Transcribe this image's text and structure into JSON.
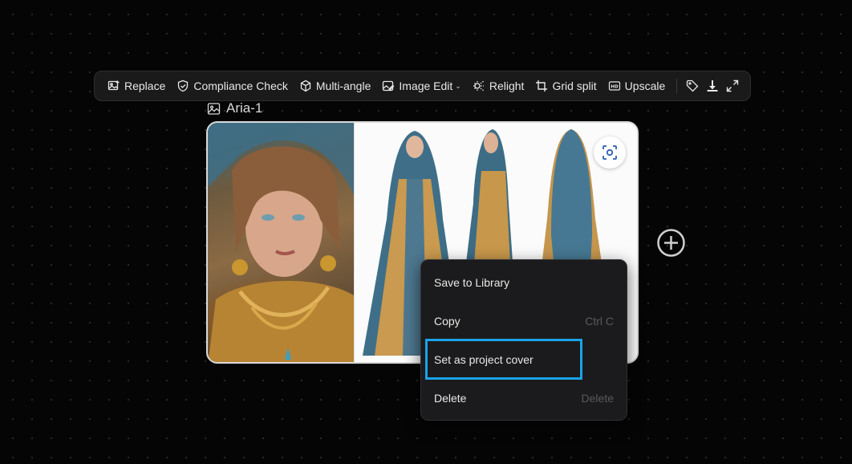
{
  "toolbar": {
    "items": [
      {
        "label": "Replace",
        "icon": "replace-image-icon"
      },
      {
        "label": "Compliance Check",
        "icon": "shield-check-icon"
      },
      {
        "label": "Multi-angle",
        "icon": "cube-icon"
      },
      {
        "label": "Image Edit",
        "icon": "image-edit-icon",
        "has_dropdown": true
      },
      {
        "label": "Relight",
        "icon": "relight-icon"
      },
      {
        "label": "Grid split",
        "icon": "crop-icon"
      },
      {
        "label": "Upscale",
        "icon": "hd-icon"
      }
    ],
    "icon_buttons": [
      "tag-icon",
      "download-icon",
      "expand-icon"
    ]
  },
  "node": {
    "title": "Aria-1",
    "icon": "image-icon"
  },
  "context_menu": {
    "items": [
      {
        "label": "Save to Library",
        "shortcut": ""
      },
      {
        "label": "Copy",
        "shortcut": "Ctrl C"
      },
      {
        "label": "Set as project cover",
        "shortcut": "",
        "highlighted": true
      },
      {
        "label": "Delete",
        "shortcut": "Delete"
      }
    ]
  },
  "colors": {
    "background": "#050505",
    "toolbar_bg": "#1a1a1a",
    "menu_bg": "#1b1b1d",
    "highlight": "#1aa3e8"
  }
}
